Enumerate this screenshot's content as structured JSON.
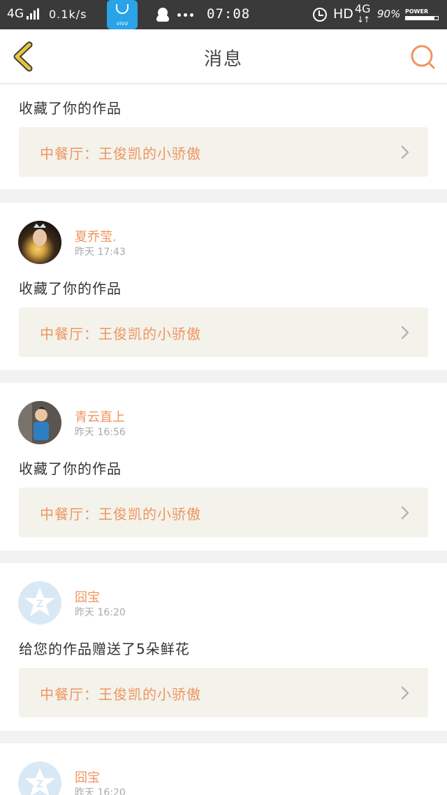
{
  "statusbar": {
    "network": "4G",
    "speed": "0.1k/s",
    "vivo_label": "vivo",
    "time": "07:08",
    "hd": "HD",
    "network2": "4G",
    "network2_arrows": "↓↑",
    "battery_pct": "90%",
    "power_label": "POWER",
    "battery_level": 0.9,
    "icons": [
      "signal-icon",
      "vivo-app-store-icon",
      "qq-icon",
      "more-dots-icon",
      "alarm-icon",
      "battery-icon"
    ]
  },
  "navbar": {
    "title": "消息",
    "back_icon": "chevron-left-icon",
    "search_icon": "search-icon",
    "accent_color": "#f0945e",
    "back_color": "#e8c53a"
  },
  "messages": [
    {
      "action": "收藏了你的作品",
      "work": "中餐厅：王俊凯的小骄傲"
    },
    {
      "user": "夏乔莹.",
      "time": "昨天 17:43",
      "action": "收藏了你的作品",
      "work": "中餐厅：王俊凯的小骄傲"
    },
    {
      "user": "青云直上",
      "time": "昨天 16:56",
      "action": "收藏了你的作品",
      "work": "中餐厅：王俊凯的小骄傲"
    },
    {
      "user": "囧宝",
      "time": "昨天 16:20",
      "action": "给您的作品赠送了5朵鲜花",
      "work": "中餐厅：王俊凯的小骄傲"
    },
    {
      "user": "囧宝",
      "time": "昨天 16:20"
    }
  ]
}
